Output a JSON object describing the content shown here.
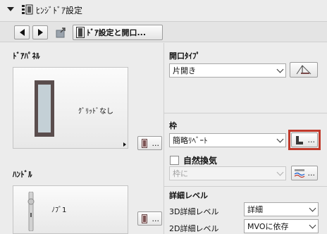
{
  "header": {
    "title": "ﾋﾝｼﾞﾄﾞｱ設定"
  },
  "nav": {
    "settings_button_label": "ﾄﾞｱ設定と開口..."
  },
  "left": {
    "door_panel_title": "ﾄﾞｱﾊﾟﾈﾙ",
    "door_panel_preview_label": "ｸﾞﾘｯﾄﾞなし",
    "handle_title": "ﾊﾝﾄﾞﾙ",
    "handle_preview_label": "ﾉﾌﾞ1",
    "dots": "..."
  },
  "right": {
    "opening_type_title": "開口ﾀｲﾌﾟ",
    "opening_type_value": "片開き",
    "frame_title": "枠",
    "frame_value": "簡略ﾘﾍﾞｰﾄ",
    "natural_ventilation_label": "自然換気",
    "ventilation_value": "枠に",
    "detail_level_title": "詳細レベル",
    "detail_3d_label": "3D詳細レベル",
    "detail_3d_value": "詳細",
    "detail_2d_label": "2D詳細レベル",
    "detail_2d_value": "MVOに依存",
    "dots": "..."
  },
  "colors": {
    "highlight_border": "#c0392b",
    "window_bg": "#ececec"
  }
}
